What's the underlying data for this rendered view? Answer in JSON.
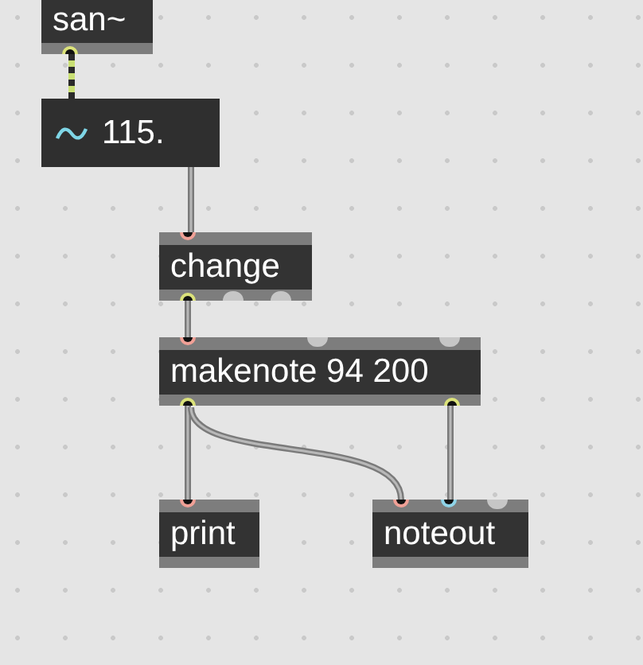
{
  "objects": [
    {
      "kind": "object",
      "text": "san~",
      "outlets": [
        {
          "kind": "signal"
        }
      ]
    },
    {
      "kind": "number",
      "text": "115."
    },
    {
      "kind": "object",
      "text": "change",
      "inlets": [
        {
          "kind": "hot"
        }
      ],
      "outlets": [
        {
          "kind": "message"
        },
        {
          "kind": "unused"
        },
        {
          "kind": "unused"
        }
      ]
    },
    {
      "kind": "object",
      "text": "makenote 94 200",
      "inlets": [
        {
          "kind": "hot"
        },
        {
          "kind": "unused"
        },
        {
          "kind": "unused"
        }
      ],
      "outlets": [
        {
          "kind": "message"
        },
        {
          "kind": "message"
        }
      ]
    },
    {
      "kind": "object",
      "text": "print",
      "inlets": [
        {
          "kind": "hot"
        }
      ]
    },
    {
      "kind": "object",
      "text": "noteout",
      "inlets": [
        {
          "kind": "hot"
        },
        {
          "kind": "cold"
        },
        {
          "kind": "unused"
        }
      ]
    }
  ],
  "cords": [
    {
      "kind": "signal"
    },
    {
      "kind": "message"
    },
    {
      "kind": "message"
    },
    {
      "kind": "message"
    },
    {
      "kind": "message"
    },
    {
      "kind": "message"
    }
  ]
}
